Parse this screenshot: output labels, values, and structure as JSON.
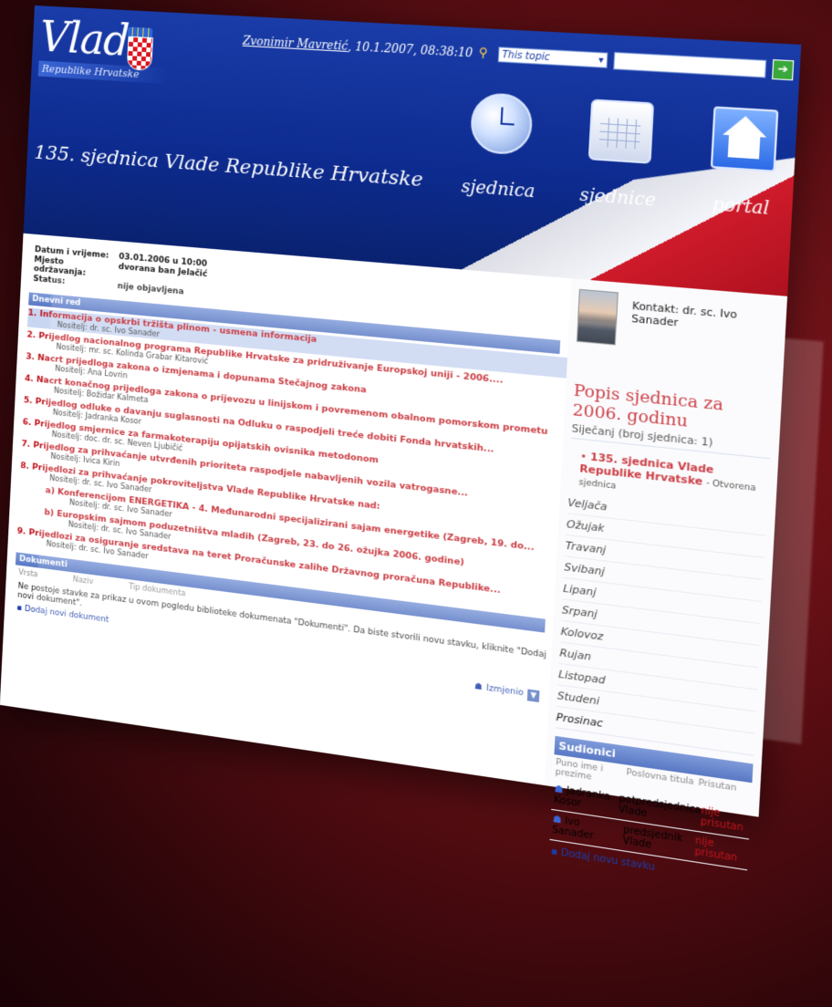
{
  "header": {
    "logo_title": "Vlada",
    "logo_subtitle": "Republike Hrvatske",
    "user": "Zvonimir Mavretić",
    "datetime": ", 10.1.2007, 08:38:10",
    "scope_label": "This topic",
    "meeting_title": "135. sjednica Vlade Republike Hrvatske",
    "nav": [
      {
        "label": "sjednica",
        "icon": "clock-icon"
      },
      {
        "label": "sjednice",
        "icon": "calendar-icon"
      },
      {
        "label": "portal",
        "icon": "home-icon"
      }
    ]
  },
  "meta": {
    "date_label": "Datum i vrijeme:",
    "date_value": "03.01.2006 u 10:00",
    "place_label": "Mjesto održavanja:",
    "place_value": "dvorana ban Jelačić",
    "status_label": "Status:",
    "status_value": "nije objavljena"
  },
  "agenda": {
    "heading": "Dnevni red",
    "items": [
      {
        "title": "1. Informacija o opskrbi tržišta plinom - usmena informacija",
        "rep": "Nositelj: dr. sc. Ivo Sanader"
      },
      {
        "title": "2. Prijedlog nacionalnog programa Republike Hrvatske za pridruživanje Europskoj uniji - 2006....",
        "rep": "Nositelj: mr. sc. Kolinda Grabar Kitarović"
      },
      {
        "title": "3. Nacrt prijedloga zakona o izmjenama i dopunama Stečajnog zakona",
        "rep": "Nositelj: Ana Lovrin"
      },
      {
        "title": "4. Nacrt konačnog prijedloga zakona o prijevozu u linijskom i povremenom obalnom pomorskom prometu",
        "rep": "Nositelj: Božidar Kalmeta"
      },
      {
        "title": "5. Prijedlog odluke o davanju suglasnosti na Odluku o raspodjeli treće dobiti Fonda hrvatskih...",
        "rep": "Nositelj: Jadranka Kosor"
      },
      {
        "title": "6. Prijedlog smjernice za farmakoterapiju opijatskih ovisnika metodonom",
        "rep": "Nositelj: doc. dr. sc. Neven Ljubičić"
      },
      {
        "title": "7. Prijedlog za prihvaćanje utvrđenih prioriteta raspodjele nabavljenih vozila vatrogasne...",
        "rep": "Nositelj: Ivica Kirin"
      },
      {
        "title": "8. Prijedlozi za prihvaćanje pokroviteljstva Vlade Republike Hrvatske nad:",
        "rep": "Nositelj: dr. sc. Ivo Sanader"
      },
      {
        "title": "a) Konferencijom ENERGETIKA - 4. Međunarodni specijalizirani sajam energetike (Zagreb, 19. do...",
        "rep": "Nositelj: dr. sc. Ivo Sanader"
      },
      {
        "title": "b) Europskim sajmom poduzetništva mladih (Zagreb, 23. do 26. ožujka 2006. godine)",
        "rep": "Nositelj: dr. sc. Ivo Sanader"
      },
      {
        "title": "9. Prijedlozi za osiguranje sredstava na teret Proračunske zalihe Državnog proračuna Republike...",
        "rep": "Nositelj: dr. sc. Ivo Sanader"
      }
    ]
  },
  "documents": {
    "heading": "Dokumenti",
    "col_type": "Vrsta",
    "col_name": "Naziv",
    "col_doctype": "Tip dokumenta",
    "empty_text": "Ne postoje stavke za prikaz u ovom pogledu biblioteke dokumenata \"Dokumenti\". Da biste stvorili novu stavku, kliknite \"Dodaj novi dokument\".",
    "add_label": "Dodaj novi dokument",
    "modified_label": "Izmjenio"
  },
  "sidebar": {
    "contact": "Kontakt: dr. sc. Ivo Sanader",
    "list_title": "Popis sjednica za 2006. godinu",
    "list_sub": "Siječanj (broj sjednica: 1)",
    "current_name": "135. sjednica Vlade Republike Hrvatske",
    "current_state": "- Otvorena sjednica",
    "months": [
      "Veljača",
      "Ožujak",
      "Travanj",
      "Svibanj",
      "Lipanj",
      "Srpanj",
      "Kolovoz",
      "Rujan",
      "Listopad",
      "Studeni",
      "Prosinac"
    ],
    "participants_heading": "Sudionici",
    "col_name": "Puno ime i prezime",
    "col_title": "Poslovna titula",
    "col_present": "Prisutan",
    "participants": [
      {
        "name": "Jadranka Kosor",
        "title": "potpredsjednica Vlade",
        "present": "nije prisutan"
      },
      {
        "name": "Ivo Sanader",
        "title": "predsjednik Vlade",
        "present": "nije prisutan"
      }
    ],
    "add_row": "Dodaj novu stavku"
  }
}
